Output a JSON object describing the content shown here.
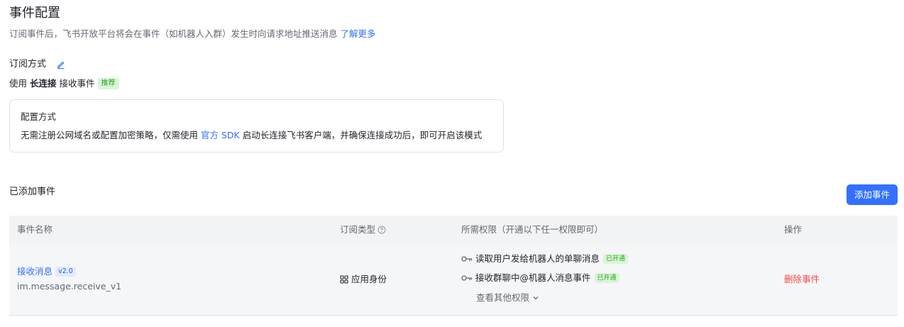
{
  "header": {
    "title": "事件配置",
    "subtitle": "订阅事件后，飞书开放平台将会在事件（如机器人入群）发生时向请求地址推送消息",
    "learn_more": "了解更多"
  },
  "subscription": {
    "label": "订阅方式",
    "use_prefix": "使用",
    "method": "长连接",
    "use_suffix": "接收事件",
    "recommend_tag": "推荐"
  },
  "config_card": {
    "title": "配置方式",
    "desc_prefix": "无需注册公网域名或配置加密策略，仅需使用",
    "sdk_link": "官方 SDK",
    "desc_suffix": "启动长连接飞书客户端，并确保连接成功后，即可开启该模式"
  },
  "events": {
    "title": "已添加事件",
    "add_button": "添加事件",
    "columns": {
      "name": "事件名称",
      "type": "订阅类型",
      "permissions": "所需权限（开通以下任一权限即可）",
      "actions": "操作"
    },
    "rows": [
      {
        "name": "接收消息",
        "version": "v2.0",
        "code": "im.message.receive_v1",
        "type": "应用身份",
        "permissions": [
          {
            "label": "读取用户发给机器人的单聊消息",
            "status": "已开通"
          },
          {
            "label": "接收群聊中@机器人消息事件",
            "status": "已开通"
          }
        ],
        "more_permissions": "查看其他权限",
        "action": "删除事件"
      }
    ]
  },
  "colors": {
    "accent": "#3370ff",
    "danger": "#f54a45",
    "success_bg": "#d9f5d6",
    "success_text": "#2ea121"
  }
}
